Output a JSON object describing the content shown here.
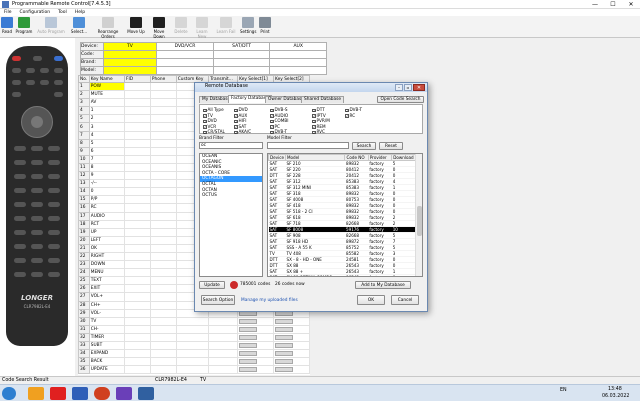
{
  "window": {
    "title": "Programmable Remote Control[7.4.5.3]",
    "controls": [
      "—",
      "☐",
      "✕"
    ]
  },
  "menu": [
    "File",
    "Configuration",
    "Tool",
    "Help"
  ],
  "toolbar": [
    {
      "label": "Read",
      "icon": "read-icon",
      "color": "#3b7bd4",
      "disabled": false
    },
    {
      "label": "Program",
      "icon": "program-icon",
      "color": "#2f9a3a",
      "disabled": false
    },
    {
      "label": "Auto Program",
      "icon": "auto-program-icon",
      "color": "#b9c7d8",
      "disabled": true
    },
    {
      "label": "Select...",
      "icon": "select-icon",
      "color": "#4f8fd8",
      "disabled": false
    },
    {
      "label": "Rearrange Orders",
      "icon": "rearrange-icon",
      "color": "#d0d0d0",
      "disabled": false
    },
    {
      "label": "Move Up",
      "icon": "move-up-icon",
      "color": "#202020",
      "disabled": false
    },
    {
      "label": "Move Down",
      "icon": "move-down-icon",
      "color": "#202020",
      "disabled": false
    },
    {
      "label": "Delete",
      "icon": "delete-icon",
      "color": "#d6d6d6",
      "disabled": true
    },
    {
      "label": "Learn New",
      "icon": "learn-new-icon",
      "color": "#d6d6d6",
      "disabled": true
    },
    {
      "label": "Learn Fail",
      "icon": "learn-fail-icon",
      "color": "#d6d6d6",
      "disabled": true
    },
    {
      "label": "Settings",
      "icon": "settings-icon",
      "color": "#9aa6b4",
      "disabled": false
    },
    {
      "label": "Print",
      "icon": "print-icon",
      "color": "#7f8a96",
      "disabled": false
    }
  ],
  "remote": {
    "brand": "LONGER",
    "model": "CLR7982L-E4"
  },
  "device_table": {
    "headers": [
      "Device:",
      "TV",
      "DVD/VCR",
      "SAT/DTT",
      "AUX"
    ],
    "rows": [
      "Code:",
      "Brand:",
      "Model:"
    ]
  },
  "key_grid": {
    "headers": [
      "No.",
      "Key Name",
      "FID",
      "Phone",
      "Custom Key",
      "Transmit...",
      "Key Select[1]",
      "Key Select[2]"
    ],
    "rows": [
      {
        "no": "1",
        "name": "POW"
      },
      {
        "no": "2",
        "name": "MUTE"
      },
      {
        "no": "3",
        "name": "AV"
      },
      {
        "no": "4",
        "name": "1"
      },
      {
        "no": "5",
        "name": "2"
      },
      {
        "no": "6",
        "name": "3"
      },
      {
        "no": "7",
        "name": "4"
      },
      {
        "no": "8",
        "name": "5"
      },
      {
        "no": "9",
        "name": "6"
      },
      {
        "no": "10",
        "name": "7"
      },
      {
        "no": "11",
        "name": "8"
      },
      {
        "no": "12",
        "name": "9"
      },
      {
        "no": "13",
        "name": "-/--"
      },
      {
        "no": "14",
        "name": "0"
      },
      {
        "no": "15",
        "name": "P/P"
      },
      {
        "no": "16",
        "name": "RC"
      },
      {
        "no": "17",
        "name": "AUDIO"
      },
      {
        "no": "18",
        "name": "RCT"
      },
      {
        "no": "19",
        "name": "UP"
      },
      {
        "no": "20",
        "name": "LEFT"
      },
      {
        "no": "21",
        "name": "OK"
      },
      {
        "no": "22",
        "name": "RIGHT"
      },
      {
        "no": "23",
        "name": "DOWN"
      },
      {
        "no": "24",
        "name": "MENU"
      },
      {
        "no": "25",
        "name": "TEXT"
      },
      {
        "no": "26",
        "name": "EXIT"
      },
      {
        "no": "27",
        "name": "VOL+"
      },
      {
        "no": "28",
        "name": "CH+"
      },
      {
        "no": "29",
        "name": "VOL-"
      },
      {
        "no": "30",
        "name": "TV"
      },
      {
        "no": "31",
        "name": "CH-"
      },
      {
        "no": "32",
        "name": "TIMER"
      },
      {
        "no": "33",
        "name": "SUBT"
      },
      {
        "no": "34",
        "name": "EXPAND"
      },
      {
        "no": "35",
        "name": "BACK"
      },
      {
        "no": "36",
        "name": "UPDATE"
      }
    ]
  },
  "dialog": {
    "title": "Remote Database",
    "tabs": [
      "My Database",
      "Factory Database",
      "Owner Database",
      "Shared Database"
    ],
    "open_code_search": "Open Code Search",
    "filters": [
      "All Type",
      "TV",
      "DVD",
      "VCR",
      "CR/STAL",
      "DVD",
      "AUX",
      "HIFI",
      "SAT",
      "AKA/C",
      "DVB-S",
      "AUDIO",
      "COMBI",
      "PC",
      "DVB-T",
      "DTT",
      "IPTV",
      "PVR/M",
      "REM",
      "RVC",
      "DVB-T",
      "RC"
    ],
    "brand_filter_label": "Brand Filter",
    "brand_filter_value": "oc",
    "model_filter_label": "Model Filter",
    "model_filter_value": "",
    "search": "Search",
    "reset": "Reset",
    "brands": [
      "OCEAN",
      "OCEANIC",
      "OCEANIS",
      "OCTA - CORE",
      "OCTAGON",
      "OCTAL",
      "OCTAN",
      "OCTUS"
    ],
    "selected_brand": "OCTAGON",
    "model_headers": [
      "Device",
      "Model",
      "Code NO",
      "Provider",
      "Download"
    ],
    "models": [
      [
        "SAT",
        "SF 210",
        "89832",
        "factory",
        "5"
      ],
      [
        "SAT",
        "SF 220",
        "80412",
        "factory",
        "0"
      ],
      [
        "DTT",
        "SF 228",
        "20412",
        "factory",
        "0"
      ],
      [
        "SAT",
        "SF 312",
        "85383",
        "factory",
        "4"
      ],
      [
        "SAT",
        "SF 312 MINI",
        "85383",
        "factory",
        "1"
      ],
      [
        "SAT",
        "SF 318",
        "89832",
        "factory",
        "0"
      ],
      [
        "SAT",
        "SF 4008",
        "80753",
        "factory",
        "0"
      ],
      [
        "SAT",
        "SF 418",
        "89832",
        "factory",
        "0"
      ],
      [
        "SAT",
        "SF 518 - 2 CI",
        "89832",
        "factory",
        "0"
      ],
      [
        "SAT",
        "SF 618",
        "89832",
        "factory",
        "2"
      ],
      [
        "SAT",
        "SF 718",
        "82668",
        "factory",
        "2"
      ],
      [
        "SAT",
        "SF 8008",
        "59176",
        "factory",
        "10"
      ],
      [
        "SAT",
        "SF 908",
        "82668",
        "factory",
        "5"
      ],
      [
        "SAT",
        "SF 918 HD",
        "89872",
        "factory",
        "7"
      ],
      [
        "SAT",
        "SSS - A 55 K",
        "85752",
        "factory",
        "5"
      ],
      [
        "TV",
        "TV 408",
        "85582",
        "factory",
        "3"
      ],
      [
        "DTT",
        "SX - 8 - HD - ONE",
        "24581",
        "factory",
        "0"
      ],
      [
        "DTT",
        "SX 88",
        "26543",
        "factory",
        "0"
      ],
      [
        "SAT",
        "SX 88 +",
        "26543",
        "factory",
        "1"
      ],
      [
        "SAT",
        "SX 88 OPTIMA COMBO",
        "86543",
        "factory",
        "0"
      ]
    ],
    "selected_model_index": 11,
    "update": "Update",
    "codes_count": "785001 codes",
    "codes_count2": "26 codes now",
    "add_to_my_db": "Add to My Database",
    "search_option": "Search Option",
    "manage_link": "Manage my uploaded files",
    "ok": "OK",
    "cancel": "Cancel"
  },
  "status": {
    "left": "Code Search Result",
    "model": "CLR7982L-E4",
    "device": "TV"
  },
  "taskbar": {
    "lang": "EN",
    "time": "13:48",
    "date": "06.03.2022"
  }
}
